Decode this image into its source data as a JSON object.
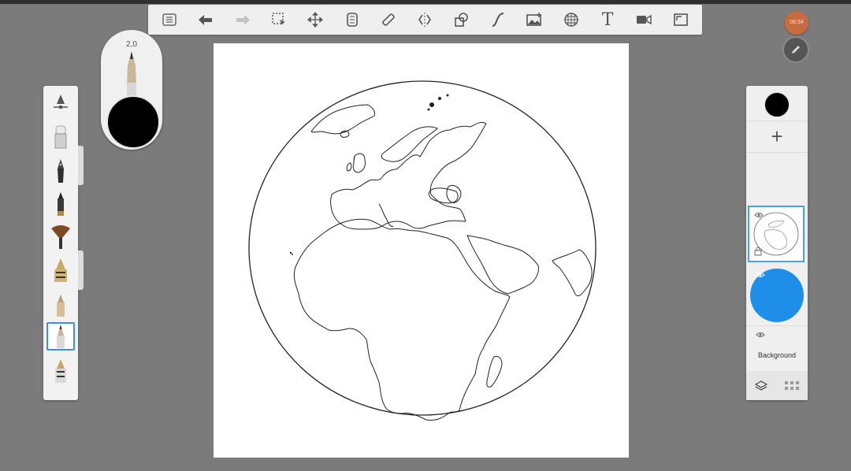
{
  "brush": {
    "size_label": "2,0"
  },
  "toolbar": {
    "tools": [
      "menu-icon",
      "undo-icon",
      "redo-icon",
      "selection-icon",
      "transform-icon",
      "ruler-icon",
      "symmetry-icon",
      "mirror-icon",
      "shape-icon",
      "curve-icon",
      "image-icon",
      "perspective-icon",
      "text-icon",
      "video-icon",
      "fullscreen-icon"
    ],
    "text_tool_label": "T"
  },
  "account": {
    "badge": "08:34"
  },
  "layers": {
    "add_label": "+",
    "background_label": "Background"
  },
  "colors": {
    "current": "#000000",
    "accent": "#1e8ee8",
    "canvas": "#ffffff",
    "workspace": "#7b7b7b"
  }
}
